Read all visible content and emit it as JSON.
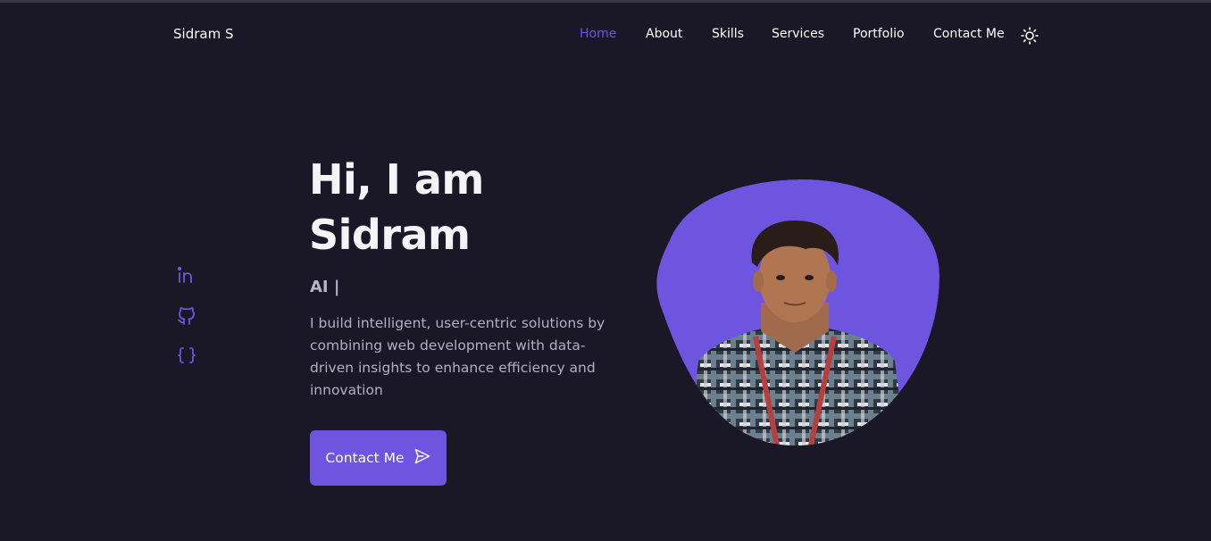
{
  "header": {
    "logo": "Sidram S",
    "nav": [
      {
        "label": "Home",
        "active": true
      },
      {
        "label": "About",
        "active": false
      },
      {
        "label": "Skills",
        "active": false
      },
      {
        "label": "Services",
        "active": false
      },
      {
        "label": "Portfolio",
        "active": false
      },
      {
        "label": "Contact Me",
        "active": false
      }
    ],
    "theme_icon": "sun-icon"
  },
  "socials": [
    {
      "icon": "linkedin-icon"
    },
    {
      "icon": "github-icon"
    },
    {
      "icon": "code-braces-icon"
    }
  ],
  "hero": {
    "title_line1": "Hi, I am",
    "title_line2": "Sidram",
    "role": "AI |",
    "description": "I build intelligent, user-centric solutions by combining web development with data-driven insights to enhance efficiency and innovation",
    "cta_label": "Contact Me",
    "cta_icon": "send-icon",
    "photo_icon": "profile-photo"
  },
  "colors": {
    "background": "#1a1727",
    "accent": "#6d55e0",
    "text": "#ffffff",
    "muted": "#b3afc2"
  }
}
